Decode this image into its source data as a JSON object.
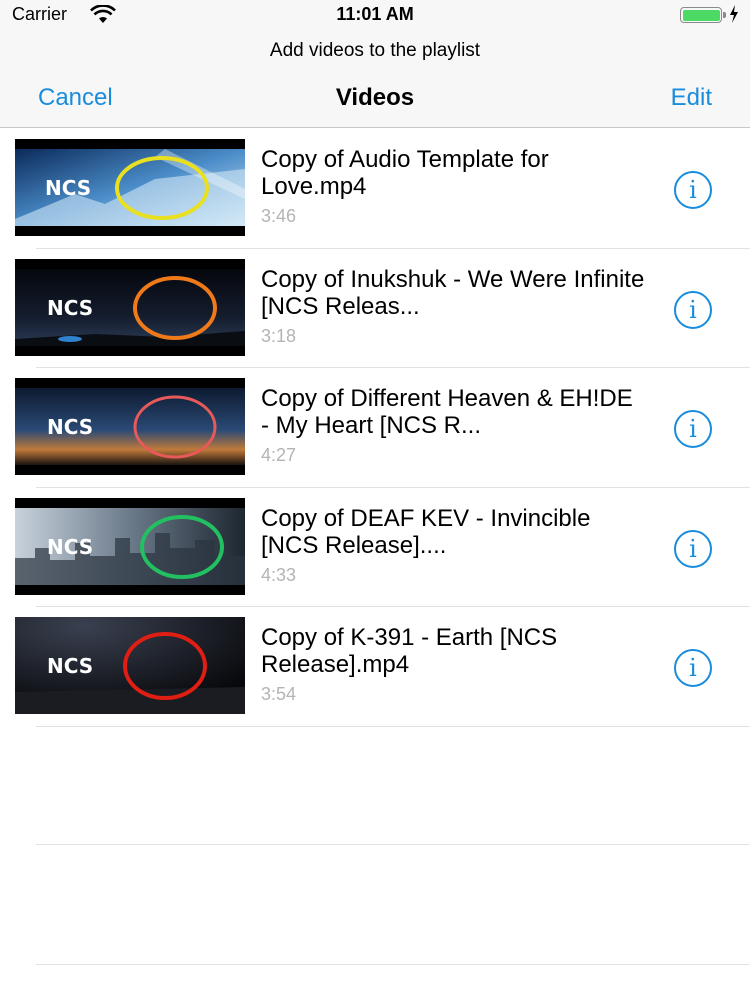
{
  "status_bar": {
    "carrier": "Carrier",
    "time": "11:01 AM",
    "wifi_icon": "wifi-icon",
    "battery_icon": "battery-charging-icon",
    "battery_level": 1.0
  },
  "header": {
    "prompt": "Add videos to the playlist",
    "cancel_label": "Cancel",
    "title": "Videos",
    "edit_label": "Edit"
  },
  "colors": {
    "tint": "#1a8cdc",
    "duration_text": "#b4b4b4",
    "nav_background": "#f7f7f7"
  },
  "thumbnails": [
    {
      "logo": "NCS",
      "ring_color": "#e8e020",
      "style": "city-blue"
    },
    {
      "logo": "NCS",
      "ring_color": "#f07a1a",
      "style": "night-sky"
    },
    {
      "logo": "NCS",
      "ring_color": "#e85a5a",
      "style": "sunset"
    },
    {
      "logo": "NCS",
      "ring_color": "#22c060",
      "style": "city-grey"
    },
    {
      "logo": "NCS",
      "ring_color": "#e01e14",
      "style": "dark"
    }
  ],
  "videos": [
    {
      "title": "Copy of Audio Template for Love.mp4",
      "duration": "3:46",
      "info_icon": "info-icon"
    },
    {
      "title": "Copy of Inukshuk - We Were Infinite [NCS Releas...",
      "duration": "3:18",
      "info_icon": "info-icon"
    },
    {
      "title": "Copy of Different Heaven & EH!DE - My Heart [NCS R...",
      "duration": "4:27",
      "info_icon": "info-icon"
    },
    {
      "title": "Copy of DEAF KEV - Invincible [NCS Release]....",
      "duration": "4:33",
      "info_icon": "info-icon"
    },
    {
      "title": "Copy of K-391 - Earth [NCS Release].mp4",
      "duration": "3:54",
      "info_icon": "info-icon"
    }
  ]
}
